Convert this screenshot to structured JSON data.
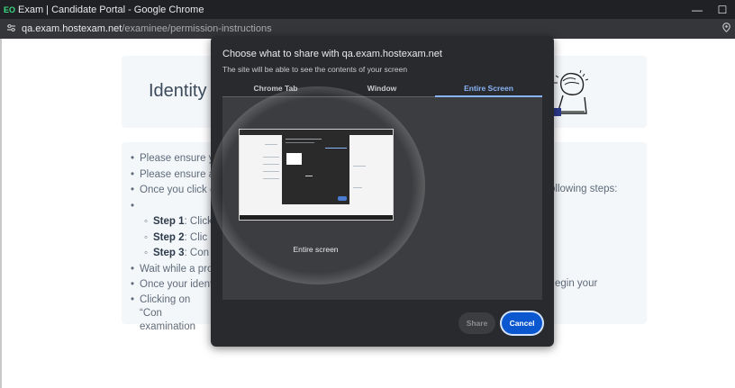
{
  "window": {
    "favicon": "EO",
    "title": "Exam | Candidate Portal - Google Chrome",
    "minimize_glyph": "—",
    "maximize_glyph": "☐"
  },
  "address_bar": {
    "host": "qa.exam.hostexam.net",
    "path": "/examinee/permission-instructions"
  },
  "page": {
    "title_fragment": "Identity",
    "items": [
      {
        "kind": "bullet",
        "text": "Please ensure yo"
      },
      {
        "kind": "bullet",
        "text": "Please ensure a"
      },
      {
        "kind": "bullet",
        "text": "Once you click c"
      },
      {
        "kind": "bullet",
        "text": ""
      },
      {
        "kind": "sub",
        "bold": "Step 1",
        "text": ": Click"
      },
      {
        "kind": "sub",
        "bold": "Step 2",
        "text": ": Clic"
      },
      {
        "kind": "sub",
        "bold": "Step 3",
        "text": ": Con"
      },
      {
        "kind": "bullet",
        "text": "Wait while a pro"
      },
      {
        "kind": "bullet",
        "text": "Once your ident"
      }
    ],
    "last_item_line1": "Clicking on “Con",
    "last_item_line2": "examination",
    "right_fragment_1": "ollowing steps:",
    "right_fragment_2": "egin your"
  },
  "dialog": {
    "title": "Choose what to share with qa.exam.hostexam.net",
    "subtitle": "The site will be able to see the contents of your screen",
    "tabs": [
      "Chrome Tab",
      "Window",
      "Entire Screen"
    ],
    "active_tab": "Entire Screen",
    "screen_label": "Entire screen",
    "share_label": "Share",
    "cancel_label": "Cancel"
  },
  "colors": {
    "accent": "#8ab4f8",
    "cancel_bg": "#0b57d0",
    "dialog_bg": "#292a2d"
  }
}
